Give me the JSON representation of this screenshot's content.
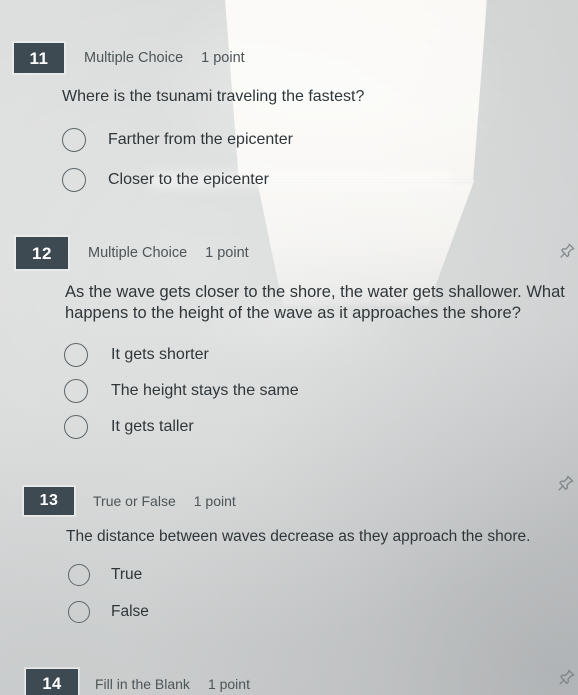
{
  "app": {
    "background_color": "#d6d8d8",
    "badge_color": "#3e4a51",
    "badge_text_color": "#ffffff",
    "text_color": "#2f3639",
    "meta_text_color": "#4c5558"
  },
  "questions": [
    {
      "number": "11",
      "type": "Multiple Choice",
      "points": "1 point",
      "text": "Where is the tsunami traveling the fastest?",
      "options": [
        {
          "label": "Farther from the epicenter",
          "selected": false
        },
        {
          "label": "Closer to the epicenter",
          "selected": false
        }
      ]
    },
    {
      "number": "12",
      "type": "Multiple Choice",
      "points": "1 point",
      "text": "As the wave gets closer to the shore, the water gets shallower. What happens to the height of the wave as it approaches the shore?",
      "options": [
        {
          "label": "It gets shorter",
          "selected": false
        },
        {
          "label": "The height stays the same",
          "selected": false
        },
        {
          "label": "It gets taller",
          "selected": false
        }
      ]
    },
    {
      "number": "13",
      "type": "True or False",
      "points": "1 point",
      "text": "The distance between waves decrease as they approach the shore.",
      "options": [
        {
          "label": "True",
          "selected": false
        },
        {
          "label": "False",
          "selected": false
        }
      ]
    },
    {
      "number": "14",
      "type": "Fill in the Blank",
      "points": "1 point",
      "text": "",
      "options": []
    }
  ],
  "icons": {
    "pin": "pin-icon"
  }
}
